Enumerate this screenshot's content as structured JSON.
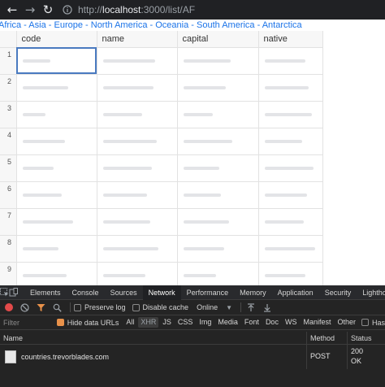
{
  "browser": {
    "url_scheme": "http://",
    "url_host": "localhost",
    "url_path": ":3000/list/AF"
  },
  "continents": [
    "Africa",
    "Asia",
    "Europe",
    "North America",
    "Oceania",
    "South America",
    "Antarctica"
  ],
  "continent_separator": " - ",
  "grid": {
    "columns": [
      "code",
      "name",
      "capital",
      "native"
    ],
    "row_numbers": [
      "1",
      "2",
      "3",
      "4",
      "5",
      "6",
      "7",
      "8",
      "9"
    ]
  },
  "devtools": {
    "tabs": [
      "Elements",
      "Console",
      "Sources",
      "Network",
      "Performance",
      "Memory",
      "Application",
      "Security",
      "Lighthouse"
    ],
    "selected_tab": "Network",
    "toolbar": {
      "preserve_log_label": "Preserve log",
      "disable_cache_label": "Disable cache",
      "throttling_value": "Online"
    },
    "filter": {
      "placeholder": "Filter",
      "hide_data_urls_label": "Hide data URLs",
      "types": [
        "All",
        "XHR",
        "JS",
        "CSS",
        "Img",
        "Media",
        "Font",
        "Doc",
        "WS",
        "Manifest",
        "Other"
      ],
      "has_blocked_label": "Has"
    },
    "table": {
      "headers": {
        "name": "Name",
        "method": "Method",
        "status": "Status"
      },
      "rows": [
        {
          "name": "countries.trevorblades.com",
          "method": "POST",
          "status_code": "200",
          "status_text": "OK"
        }
      ]
    }
  }
}
